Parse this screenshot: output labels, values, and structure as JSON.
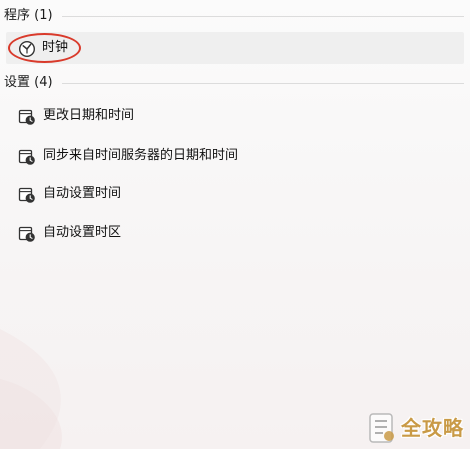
{
  "sections": {
    "programs": {
      "header": "程序 (1)",
      "items": [
        {
          "label": "时钟",
          "icon": "clock-app-icon"
        }
      ]
    },
    "settings": {
      "header": "设置 (4)",
      "items": [
        {
          "label": "更改日期和时间",
          "icon": "calendar-clock-icon"
        },
        {
          "label": "同步来自时间服务器的日期和时间",
          "icon": "calendar-clock-icon"
        },
        {
          "label": "自动设置时间",
          "icon": "calendar-clock-icon"
        },
        {
          "label": "自动设置时区",
          "icon": "calendar-clock-icon"
        }
      ]
    }
  },
  "annotation": {
    "color": "#d93a2b",
    "target": "时钟"
  },
  "watermark": {
    "text": "全攻略",
    "logo": "watermark-logo",
    "color": "#c99a46"
  },
  "colors": {
    "highlight_row": "#efefef",
    "divider": "#dcdcdc",
    "icon_stroke": "#333333"
  }
}
